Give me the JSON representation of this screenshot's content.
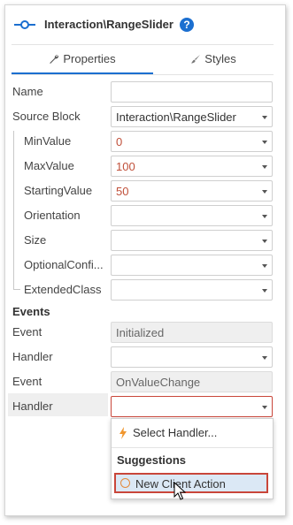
{
  "header": {
    "title": "Interaction\\RangeSlider",
    "help_label": "?",
    "block_icon": "range-slider-icon"
  },
  "tabs": [
    {
      "label": "Properties",
      "icon": "wrench-icon",
      "active": true
    },
    {
      "label": "Styles",
      "icon": "brush-icon",
      "active": false
    }
  ],
  "properties": {
    "name": {
      "label": "Name",
      "value": ""
    },
    "source_block": {
      "label": "Source Block",
      "value": "Interaction\\RangeSlider"
    },
    "min_value": {
      "label": "MinValue",
      "value": "0"
    },
    "max_value": {
      "label": "MaxValue",
      "value": "100"
    },
    "starting_value": {
      "label": "StartingValue",
      "value": "50"
    },
    "orientation": {
      "label": "Orientation",
      "value": ""
    },
    "size": {
      "label": "Size",
      "value": ""
    },
    "optional_config": {
      "label": "OptionalConfi...",
      "value": ""
    },
    "extended_class": {
      "label": "ExtendedClass",
      "value": ""
    }
  },
  "events": {
    "title": "Events",
    "event1": {
      "label": "Event",
      "value": "Initialized"
    },
    "handler1": {
      "label": "Handler",
      "value": ""
    },
    "event2": {
      "label": "Event",
      "value": "OnValueChange"
    },
    "handler2": {
      "label": "Handler",
      "value": ""
    }
  },
  "dropdown": {
    "select_handler": "Select Handler...",
    "suggestions_title": "Suggestions",
    "new_client_action": "New Client Action"
  },
  "colors": {
    "accent": "#1b6fd0",
    "value_orange": "#c0503a",
    "highlight_border": "#c9463a",
    "selection_bg": "#dbe8f5"
  }
}
